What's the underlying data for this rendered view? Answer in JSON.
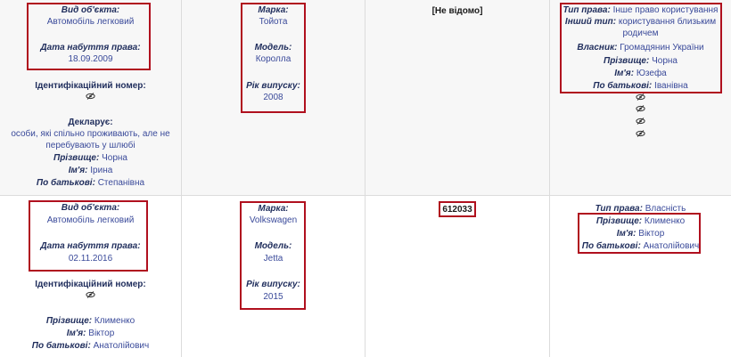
{
  "rows": [
    {
      "object": {
        "type_label": "Вид об'єкта:",
        "type_value": "Автомобіль легковий",
        "date_label": "Дата набуття права:",
        "date_value": "18.09.2009",
        "id_label": "Ідентифікаційний номер:",
        "declarant_label": "Декларує:",
        "declarant_value_line1": "особи, які спільно проживають, але не",
        "declarant_value_line2": "перебувають у шлюбі",
        "surname_label": "Прізвище:",
        "surname_value": "Чорна",
        "name_label": "Ім'я:",
        "name_value": "Ірина",
        "patronymic_label": "По батькові:",
        "patronymic_value": "Степанівна"
      },
      "vehicle": {
        "brand_label": "Марка:",
        "brand_value": "Тойота",
        "model_label": "Модель:",
        "model_value": "Королла",
        "year_label": "Рік випуску:",
        "year_value": "2008"
      },
      "cost": "[Не відомо]",
      "owner": {
        "right_label": "Тип права:",
        "right_value": "Інше право користування",
        "other_label": "Інший тип:",
        "other_value_line1": "користування близьким",
        "other_value_line2": "родичем",
        "owner_label": "Власник:",
        "owner_value": "Громадянин України",
        "surname_label": "Прізвище:",
        "surname_value": "Чорна",
        "name_label": "Ім'я:",
        "name_value": "Юзефа",
        "patronymic_label": "По батькові:",
        "patronymic_value": "Іванівна"
      }
    },
    {
      "object": {
        "type_label": "Вид об'єкта:",
        "type_value": "Автомобіль легковий",
        "date_label": "Дата набуття права:",
        "date_value": "02.11.2016",
        "id_label": "Ідентифікаційний номер:",
        "surname_label": "Прізвище:",
        "surname_value": "Клименко",
        "name_label": "Ім'я:",
        "name_value": "Віктор",
        "patronymic_label": "По батькові:",
        "patronymic_value": "Анатолійович"
      },
      "vehicle": {
        "brand_label": "Марка:",
        "brand_value": "Volkswagen",
        "model_label": "Модель:",
        "model_value": "Jetta",
        "year_label": "Рік випуску:",
        "year_value": "2015"
      },
      "cost": "612033",
      "owner": {
        "right_label": "Тип права:",
        "right_value": "Власність",
        "surname_label": "Прізвище:",
        "surname_value": "Клименко",
        "name_label": "Ім'я:",
        "name_value": "Віктор",
        "patronymic_label": "По батькові:",
        "patronymic_value": "Анатолійович"
      }
    }
  ],
  "icons": {
    "hidden_info": "eye-slash-icon"
  },
  "colors": {
    "highlight_border": "#b0101e",
    "label": "#1f2d5c",
    "value": "#3a4a9a"
  }
}
